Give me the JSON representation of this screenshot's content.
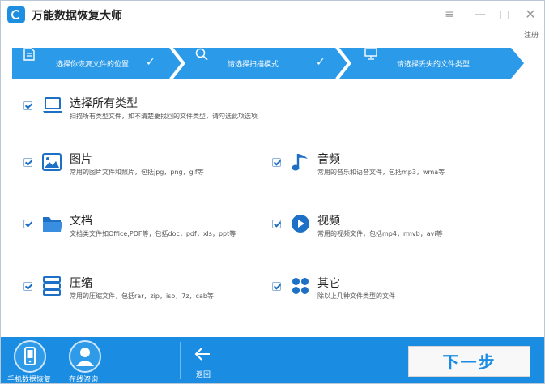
{
  "app": {
    "title": "万能数据恢复大师",
    "register": "注册",
    "window_controls": {
      "menu": "≡",
      "minimize": "—",
      "maximize": "□",
      "close": "✕"
    }
  },
  "steps": [
    {
      "label": "选择你恢复文件的位置",
      "icon": "document-icon",
      "done": true
    },
    {
      "label": "请选择扫描模式",
      "icon": "search-icon",
      "done": true
    },
    {
      "label": "请选择丢失的文件类型",
      "icon": "monitor-icon",
      "done": false
    }
  ],
  "options": {
    "all": {
      "title": "选择所有类型",
      "desc": "扫描所有类型文件，如不清楚要找回的文件类型，请勾选此项选项",
      "icon": "laptop-icon",
      "checked": true
    },
    "images": {
      "title": "图片",
      "desc": "常用的图片文件和照片，包括jpg，png，gif等",
      "icon": "image-icon",
      "checked": true
    },
    "audio": {
      "title": "音频",
      "desc": "常用的音乐和语音文件，包括mp3，wma等",
      "icon": "music-note-icon",
      "checked": true
    },
    "docs": {
      "title": "文档",
      "desc": "文档类文件如Office,PDF等，包括doc，pdf，xls，ppt等",
      "icon": "folder-icon",
      "checked": true
    },
    "video": {
      "title": "视频",
      "desc": "常用的视频文件，包括mp4，rmvb，avi等",
      "icon": "play-icon",
      "checked": true
    },
    "archive": {
      "title": "压缩",
      "desc": "常用的压缩文件，包括rar，zip，iso，7z，cab等",
      "icon": "archive-icon",
      "checked": true
    },
    "other": {
      "title": "其它",
      "desc": "除以上几种文件类型的文件",
      "icon": "grid-dots-icon",
      "checked": true
    }
  },
  "bottom": {
    "phone_recovery": "手机数据恢复",
    "online_consult": "在线咨询",
    "back": "返回",
    "next": "下一步"
  },
  "colors": {
    "accent": "#1a8de3",
    "steps_bg": "#2b9ae8",
    "icon_blue": "#1e6fc6"
  }
}
